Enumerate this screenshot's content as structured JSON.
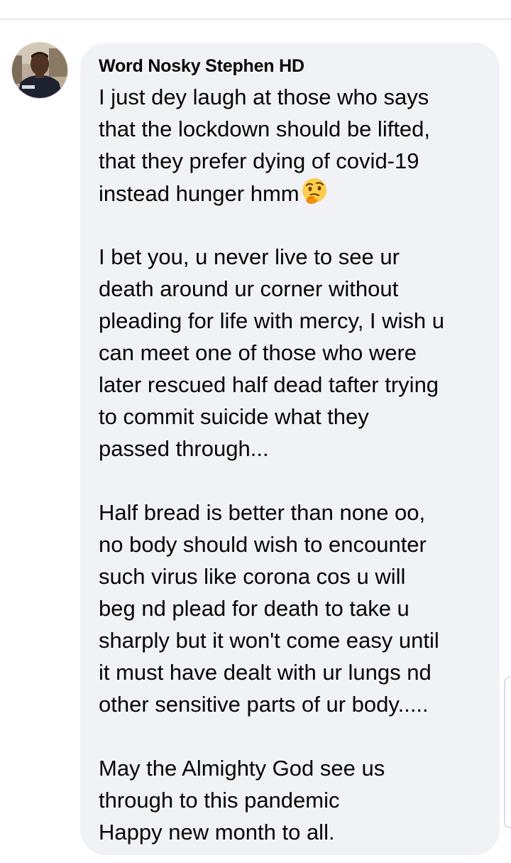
{
  "comment": {
    "author": "Word Nosky Stephen HD",
    "emoji_icon": "thinking-face-icon",
    "lines": [
      "I just dey laugh at those who says",
      "that the lockdown should be lifted,",
      "that they prefer dying of covid-19",
      "instead hunger hmm",
      "",
      "I bet you, u never live to see ur",
      "death around ur corner without",
      "pleading for life with mercy, I wish u",
      "can meet one of those who were",
      "later rescued half dead tafter trying",
      "to commit suicide what they",
      "passed through...",
      "",
      "Half bread is better than none oo,",
      "no body should wish to encounter",
      "such virus like corona cos u will",
      "beg nd plead for death to take u",
      "sharply but it won't come easy until",
      "it must have dealt with ur lungs nd",
      "other sensitive parts of ur body.....",
      "",
      "May the Almighty God see us",
      "through to this pandemic",
      "Happy new month to all."
    ]
  },
  "colors": {
    "bubble_bg": "#f0f2f5",
    "text": "#050505",
    "divider": "#e4e6eb"
  }
}
